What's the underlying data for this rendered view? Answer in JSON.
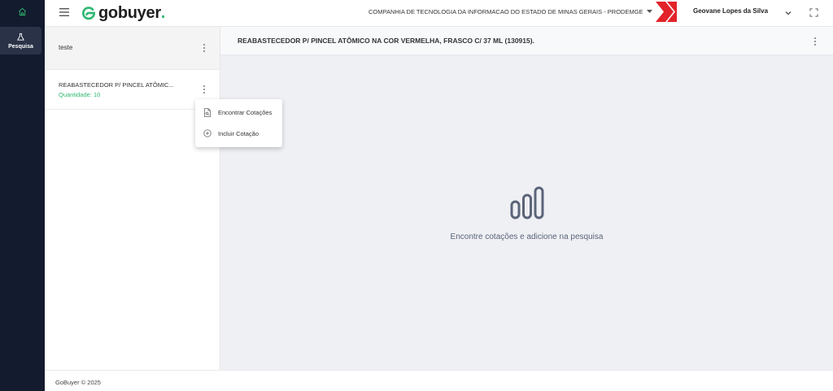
{
  "app": {
    "logo_text": "gobuyer",
    "logo_dot": ".",
    "brand_color": "#2eb872"
  },
  "rail": {
    "home_icon": "home-icon",
    "items": [
      {
        "label": "Pesquisa",
        "icon": "flask-icon"
      }
    ]
  },
  "header": {
    "company": "COMPANHIA DE TECNOLOGIA DA INFORMACAO DO ESTADO DE MINAS GERAIS - PRODEMGE",
    "user_name": "Geovane Lopes da Silva"
  },
  "list": {
    "items": [
      {
        "title": "teste"
      },
      {
        "title": "REABASTECEDOR P/ PINCEL ATÔMIC...",
        "quantity": "Quantidade: 10"
      }
    ]
  },
  "context_menu": {
    "items": [
      {
        "label": "Encontrar Cotações",
        "icon": "document-search-icon"
      },
      {
        "label": "Incluir Cotação",
        "icon": "plus-circle-icon"
      }
    ]
  },
  "main": {
    "title": "REABASTECEDOR P/ PINCEL ATÔMICO NA COR VERMELHA, FRASCO C/ 37 ML (130915).",
    "empty_text": "Encontre cotações e adicione na pesquisa",
    "empty_icon": "bar-chart-icon"
  },
  "footer": {
    "text": "GoBuyer © 2025"
  }
}
